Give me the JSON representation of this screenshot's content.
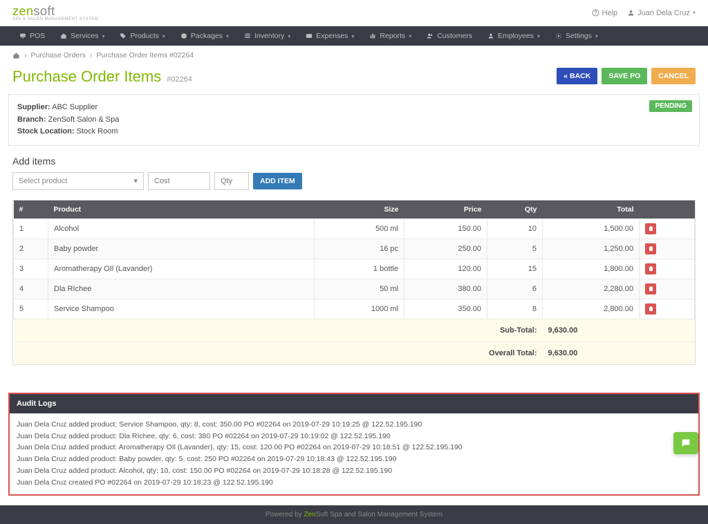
{
  "brand": {
    "name_colored": "zen",
    "name_rest": "soft",
    "tagline": "SPA & SALON MANAGEMENT SYSTEM"
  },
  "top_right": {
    "help": "Help",
    "user": "Juan Dela Cruz"
  },
  "nav": {
    "items": [
      "POS",
      "Services",
      "Products",
      "Packages",
      "Inventory",
      "Expenses",
      "Reports",
      "Customers",
      "Employees",
      "Settings"
    ]
  },
  "breadcrumbs": {
    "a": "Purchase Orders",
    "b": "Purchase Order Items #02264"
  },
  "page": {
    "title": "Purchase Order Items",
    "sub": "#02264"
  },
  "actions": {
    "back": "« BACK",
    "save": "SAVE PO",
    "cancel": "CANCEL"
  },
  "meta": {
    "supplier_label": "Supplier:",
    "supplier": "ABC Supplier",
    "branch_label": "Branch:",
    "branch": "ZenSoft Salon & Spa",
    "stock_label": "Stock Location:",
    "stock": "Stock Room",
    "status": "PENDING"
  },
  "add_items": {
    "heading": "Add items",
    "select_placeholder": "Select product",
    "cost_placeholder": "Cost",
    "qty_placeholder": "Qty",
    "add_btn": "ADD ITEM"
  },
  "table": {
    "headers": {
      "num": "#",
      "product": "Product",
      "size": "Size",
      "price": "Price",
      "qty": "Qty",
      "total": "Total"
    },
    "rows": [
      {
        "n": "1",
        "product": "Alcohol",
        "size": "500 ml",
        "price": "150.00",
        "qty": "10",
        "total": "1,500.00"
      },
      {
        "n": "2",
        "product": "Baby powder",
        "size": "16 pc",
        "price": "250.00",
        "qty": "5",
        "total": "1,250.00"
      },
      {
        "n": "3",
        "product": "Aromatherapy OIl (Lavander)",
        "size": "1 bottle",
        "price": "120.00",
        "qty": "15",
        "total": "1,800.00"
      },
      {
        "n": "4",
        "product": "Dla RIchee",
        "size": "50 ml",
        "price": "380.00",
        "qty": "6",
        "total": "2,280.00"
      },
      {
        "n": "5",
        "product": "Service Shampoo",
        "size": "1000 ml",
        "price": "350.00",
        "qty": "8",
        "total": "2,800.00"
      }
    ],
    "subtotal_label": "Sub-Total:",
    "subtotal": "9,630.00",
    "overall_label": "Overall Total:",
    "overall": "9,630.00"
  },
  "audit": {
    "title": "Audit Logs",
    "lines": [
      "Juan Dela Cruz added product: Service Shampoo, qty: 8, cost: 350.00 PO #02264 on 2019-07-29 10:19:25 @ 122.52.195.190",
      "Juan Dela Cruz added product: Dla RIchee, qty: 6, cost: 380 PO #02264 on 2019-07-29 10:19:02 @ 122.52.195.190",
      "Juan Dela Cruz added product: Aromatherapy OIl (Lavander), qty: 15, cost: 120.00 PO #02264 on 2019-07-29 10:18:51 @ 122.52.195.190",
      "Juan Dela Cruz added product: Baby powder, qty: 5, cost: 250 PO #02264 on 2019-07-29 10:18:43 @ 122.52.195.190",
      "Juan Dela Cruz added product: Alcohol, qty: 10, cost: 150.00 PO #02264 on 2019-07-29 10:18:28 @ 122.52.195.190",
      "Juan Dela Cruz created PO #02264 on 2019-07-29 10:18:23 @ 122.52.195.190"
    ]
  },
  "footer": {
    "pre": "Powered by ",
    "brand1": "Zen",
    "brand2": "Soft",
    "post": " Spa and Salon Management System"
  }
}
